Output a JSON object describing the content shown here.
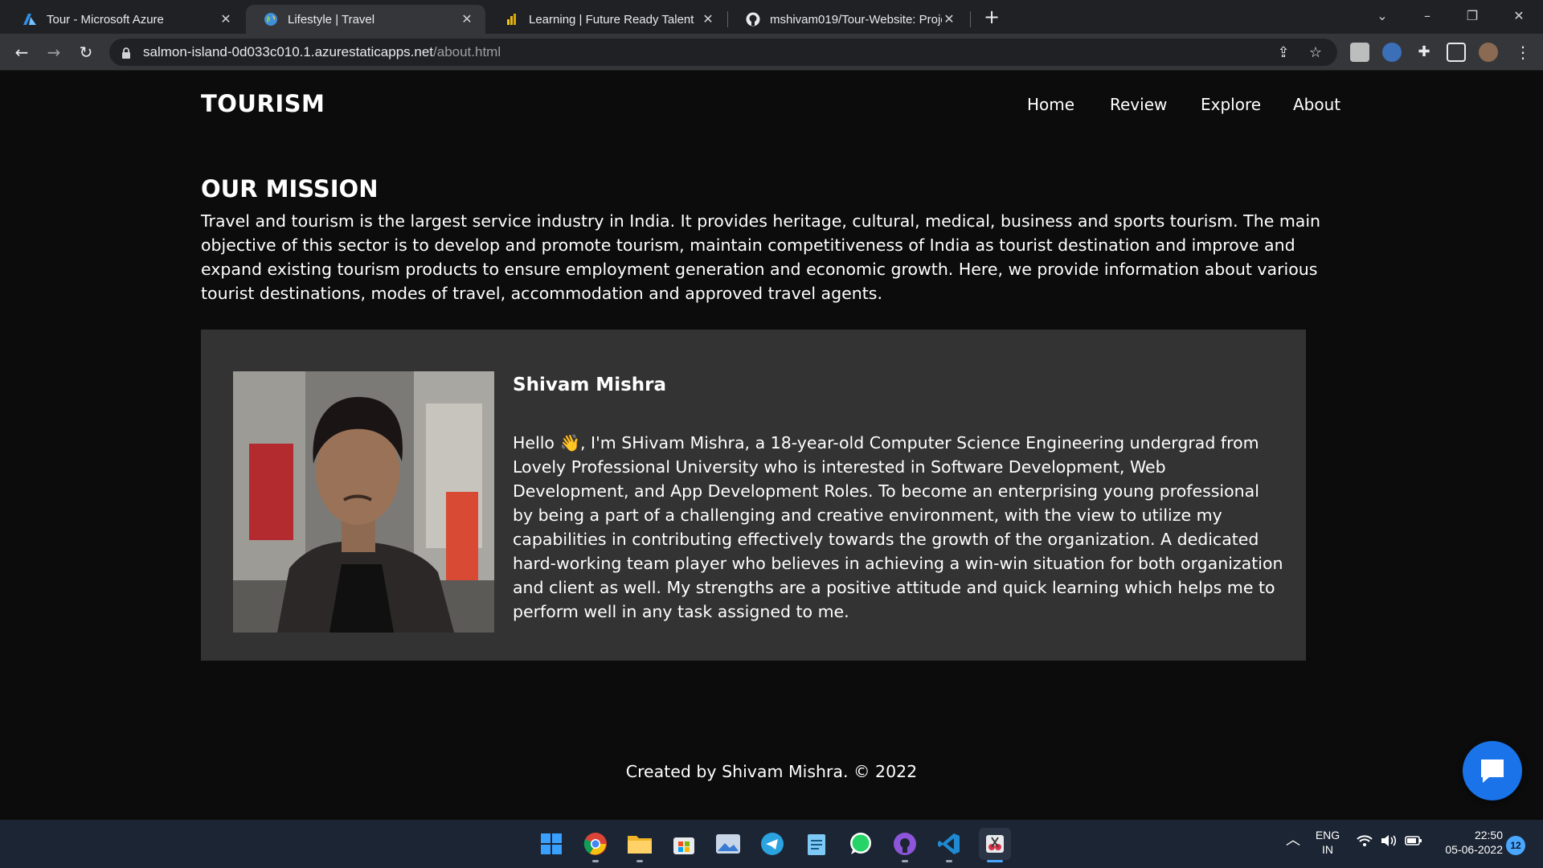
{
  "browser": {
    "tabs": [
      {
        "title": "Tour - Microsoft Azure",
        "icon": "azure-icon",
        "active": false
      },
      {
        "title": "Lifestyle | Travel",
        "icon": "globe-icon",
        "active": true
      },
      {
        "title": "Learning | Future Ready Talent",
        "icon": "power-bi-icon",
        "active": false
      },
      {
        "title": "mshivam019/Tour-Website: Proje",
        "icon": "github-icon",
        "active": false
      }
    ],
    "new_tab_label": "+",
    "url_host": "salmon-island-0d033c010.1.azurestaticapps.net",
    "url_path": "/about.html"
  },
  "site": {
    "brand": "TOURISM",
    "nav": [
      "Home",
      "Review",
      "Explore",
      "About"
    ],
    "mission_title": "OUR MISSION",
    "mission_text": "Travel and tourism is the largest service industry in India. It provides heritage, cultural, medical, business and sports tourism. The main objective of this sector is to develop and promote tourism, maintain competitiveness of India as tourist destination and improve and expand existing tourism products to ensure employment generation and economic growth. Here, we provide information about various tourist destinations, modes of travel, accommodation and approved travel agents.",
    "profile": {
      "name": "Shivam Mishra",
      "bio": "Hello 👋, I'm SHivam Mishra, a 18-year-old Computer Science Engineering undergrad from Lovely Professional University who is interested in Software Development, Web Development, and App Development Roles. To become an enterprising young professional by being a part of a challenging and creative environment, with the view to utilize my capabilities in contributing effectively towards the growth of the organization. A dedicated hard-working team player who believes in achieving a win-win situation for both organization and client as well. My strengths are a positive attitude and quick learning which helps me to perform well in any task assigned to me."
    },
    "footer": "Created by Shivam Mishra. © 2022"
  },
  "taskbar": {
    "apps": [
      "windows-start-icon",
      "chrome-icon",
      "file-explorer-icon",
      "microsoft-store-icon",
      "photos-icon",
      "telegram-icon",
      "notepad-icon",
      "whatsapp-icon",
      "github-desktop-icon",
      "vscode-icon",
      "snipping-tool-icon"
    ],
    "lang_line1": "ENG",
    "lang_line2": "IN",
    "time": "22:50",
    "date": "05-06-2022",
    "notifications": "12"
  },
  "colors": {
    "page_bg": "#0c0c0c",
    "card_bg": "#333333",
    "accent": "#1a73e8",
    "taskbar_bg": "#1c2533"
  }
}
